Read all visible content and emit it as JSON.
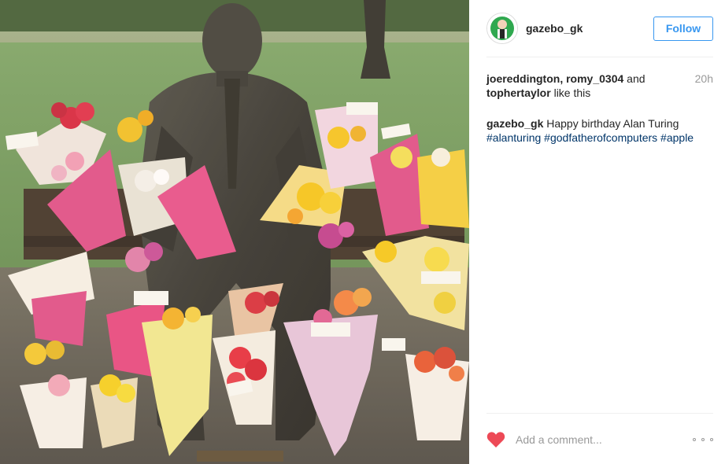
{
  "post": {
    "username": "gazebo_gk",
    "follow_label": "Follow",
    "time_ago": "20h",
    "likes": {
      "user1": "joereddington",
      "sep1": ", ",
      "user2": "romy_0304",
      "sep2": " and ",
      "user3": "tophertaylor",
      "suffix": " like this"
    },
    "caption": {
      "user": "gazebo_gk",
      "text": "Happy birthday Alan Turing",
      "hashtags": [
        "#alanturing",
        "#godfatherofcomputers",
        "#apple"
      ]
    },
    "comment_placeholder": "Add a comment..."
  },
  "colors": {
    "accent": "#3897f0",
    "like_heart": "#ed4956",
    "hashtag": "#003569",
    "muted": "#999999"
  },
  "icons": {
    "like": "heart-icon",
    "more": "more-options-icon"
  }
}
